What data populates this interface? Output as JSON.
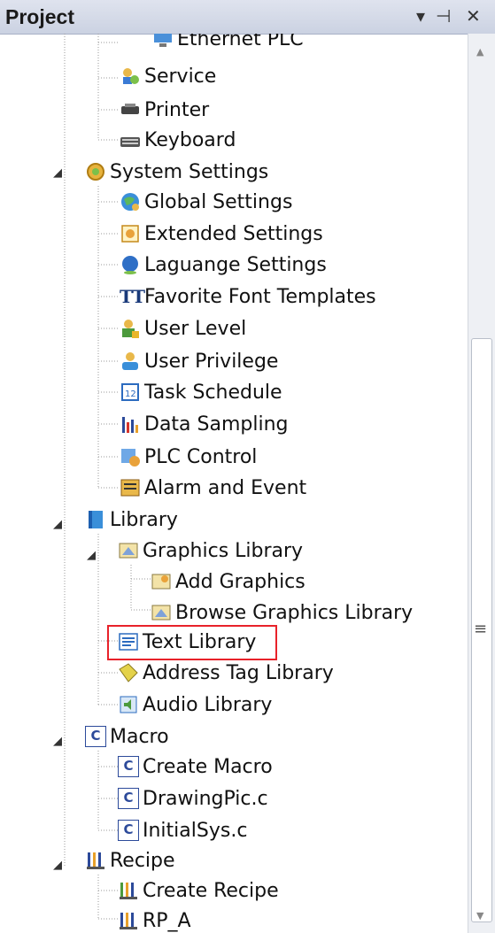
{
  "panel": {
    "title": "Project",
    "pin_glyph": "▾ ⊣ ✕"
  },
  "tree": {
    "ethernet_plc": "Ethernet PLC",
    "service": "Service",
    "printer": "Printer",
    "keyboard": "Keyboard",
    "system_settings": "System Settings",
    "global_settings": "Global Settings",
    "extended_settings": "Extended Settings",
    "language_settings": "Laguange Settings",
    "favorite_font_templates": "Favorite Font Templates",
    "user_level": "User Level",
    "user_privilege": "User Privilege",
    "task_schedule": "Task Schedule",
    "data_sampling": "Data Sampling",
    "plc_control": "PLC Control",
    "alarm_and_event": "Alarm and Event",
    "library": "Library",
    "graphics_library": "Graphics Library",
    "add_graphics": "Add Graphics",
    "browse_graphics_library": "Browse Graphics Library",
    "text_library": "Text Library",
    "address_tag_library": "Address Tag Library",
    "audio_library": "Audio Library",
    "macro": "Macro",
    "create_macro": "Create Macro",
    "drawingpic": "DrawingPic.c",
    "initialsys": "InitialSys.c",
    "recipe": "Recipe",
    "create_recipe": "Create Recipe",
    "rp_a": "RP_A"
  },
  "icons": {
    "tt": "TT",
    "c": "C",
    "twelve": "12"
  },
  "colors": {
    "highlight": "#e8222a",
    "titlebar": "#cbd2e2"
  }
}
